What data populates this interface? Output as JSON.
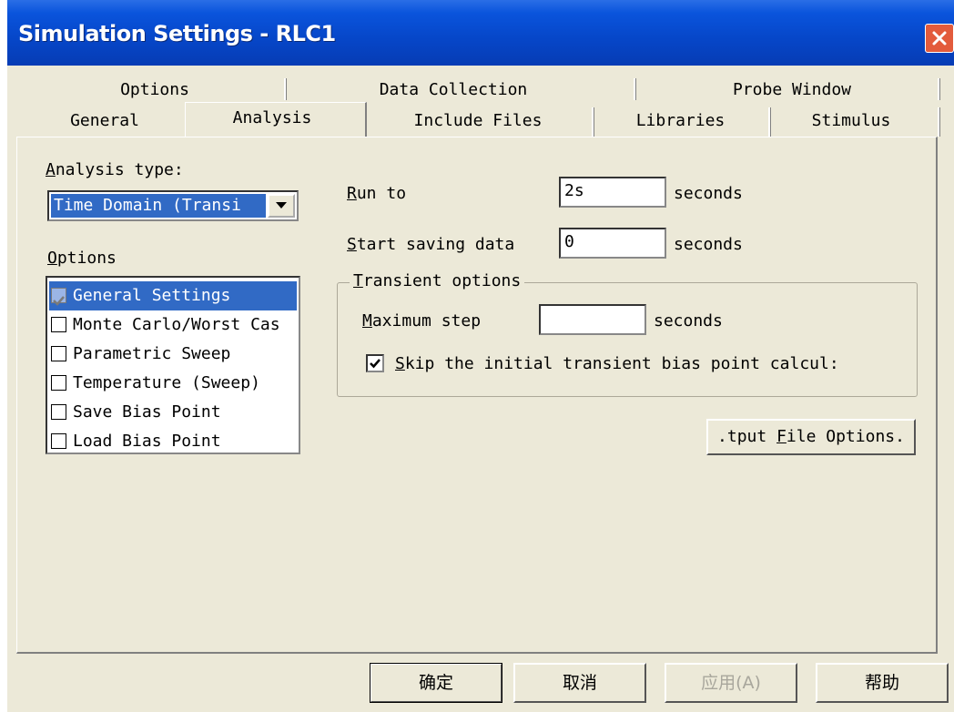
{
  "window": {
    "title": "Simulation Settings - RLC1"
  },
  "tabs_row1": [
    "Options",
    "Data Collection",
    "Probe Window"
  ],
  "tabs_row2": [
    "General",
    "Analysis",
    "Include Files",
    "Libraries",
    "Stimulus"
  ],
  "active_tab": "Analysis",
  "analysis_type": {
    "label": "Analysis type:",
    "accel": "A",
    "value": "Time Domain (Transi"
  },
  "options": {
    "label": "Options",
    "accel": "O",
    "items": [
      {
        "label": "General Settings",
        "checked": true,
        "selected": true,
        "disabled": true
      },
      {
        "label": "Monte Carlo/Worst Cas",
        "checked": false
      },
      {
        "label": "Parametric Sweep",
        "checked": false
      },
      {
        "label": "Temperature (Sweep)",
        "checked": false
      },
      {
        "label": "Save Bias Point",
        "checked": false
      },
      {
        "label": "Load Bias Point",
        "checked": false
      }
    ]
  },
  "run_to": {
    "label_accel": "R",
    "label_rest": "un to",
    "value": "2s",
    "unit": "seconds"
  },
  "start_saving": {
    "label_accel": "S",
    "label_rest": "tart saving data",
    "value": "0",
    "unit": "seconds"
  },
  "transient": {
    "legend_accel": "T",
    "legend_rest": "ransient options",
    "max_step_accel": "M",
    "max_step_rest": "aximum step",
    "max_step_value": "",
    "max_step_unit": "seconds",
    "skip_accel": "S",
    "skip_rest": "kip the initial transient bias point calcul:",
    "skip_checked": true
  },
  "output_button": {
    "prefix": ".tput ",
    "accel": "F",
    "rest": "ile Options."
  },
  "footer": {
    "ok": "确定",
    "cancel": "取消",
    "apply": "应用(A)",
    "help": "帮助"
  }
}
